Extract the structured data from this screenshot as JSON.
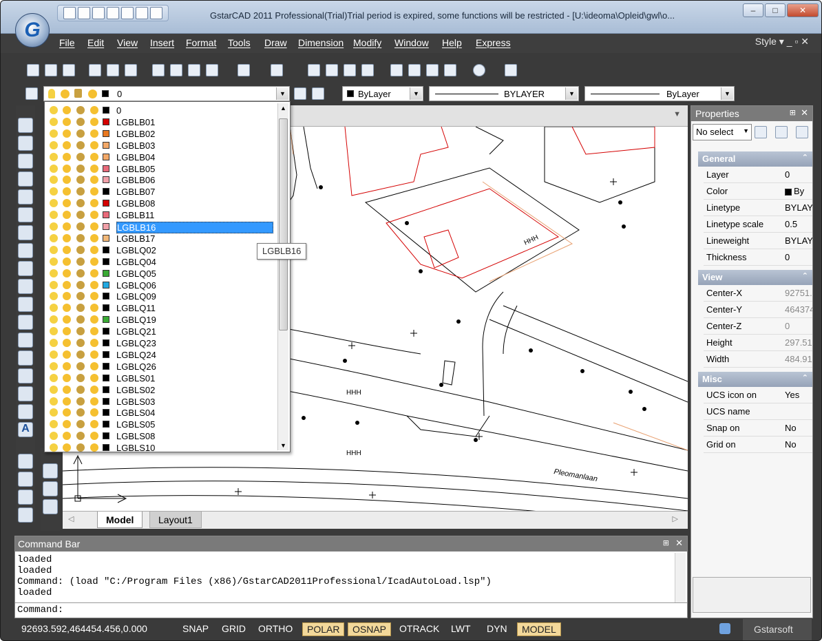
{
  "window": {
    "title": "GstarCAD 2011 Professional(Trial)Trial period is expired, some functions will be restricted - [U:\\ideoma\\Opleid\\gwl\\o...",
    "app_logo": "G",
    "min": "–",
    "max": "□",
    "close": "✕"
  },
  "menus": [
    "File",
    "Edit",
    "View",
    "Insert",
    "Format",
    "Tools",
    "Draw",
    "Dimension",
    "Modify",
    "Window",
    "Help",
    "Express"
  ],
  "style_label": "Style ▾ _ ▫ ✕",
  "layer_combo": {
    "value": "0"
  },
  "color_combo": {
    "value": "ByLayer"
  },
  "linetype_combo": {
    "value": "BYLAYER"
  },
  "lineweight_combo": {
    "value": "ByLayer"
  },
  "layer_dropdown": {
    "items": [
      {
        "name": "0",
        "color": "#000000"
      },
      {
        "name": "LGBLB01",
        "color": "#d40000"
      },
      {
        "name": "LGBLB02",
        "color": "#e87820"
      },
      {
        "name": "LGBLB03",
        "color": "#f2a868"
      },
      {
        "name": "LGBLB04",
        "color": "#f2a868"
      },
      {
        "name": "LGBLB05",
        "color": "#e86a7a"
      },
      {
        "name": "LGBLB06",
        "color": "#f0a0a8"
      },
      {
        "name": "LGBLB07",
        "color": "#000000"
      },
      {
        "name": "LGBLB08",
        "color": "#d40000"
      },
      {
        "name": "LGBLB11",
        "color": "#e86a7a"
      },
      {
        "name": "LGBLB16",
        "color": "#f0a0a8"
      },
      {
        "name": "LGBLB17",
        "color": "#f2b878"
      },
      {
        "name": "LGBLQ02",
        "color": "#000000"
      },
      {
        "name": "LGBLQ04",
        "color": "#000000"
      },
      {
        "name": "LGBLQ05",
        "color": "#3aaa35"
      },
      {
        "name": "LGBLQ06",
        "color": "#22a8e0"
      },
      {
        "name": "LGBLQ09",
        "color": "#000000"
      },
      {
        "name": "LGBLQ11",
        "color": "#000000"
      },
      {
        "name": "LGBLQ19",
        "color": "#3aaa35"
      },
      {
        "name": "LGBLQ21",
        "color": "#000000"
      },
      {
        "name": "LGBLQ23",
        "color": "#000000"
      },
      {
        "name": "LGBLQ24",
        "color": "#000000"
      },
      {
        "name": "LGBLQ26",
        "color": "#000000"
      },
      {
        "name": "LGBLS01",
        "color": "#000000"
      },
      {
        "name": "LGBLS02",
        "color": "#000000"
      },
      {
        "name": "LGBLS03",
        "color": "#000000"
      },
      {
        "name": "LGBLS04",
        "color": "#000000"
      },
      {
        "name": "LGBLS05",
        "color": "#000000"
      },
      {
        "name": "LGBLS08",
        "color": "#000000"
      },
      {
        "name": "LGBLS10",
        "color": "#000000"
      }
    ],
    "selected": "LGBLB16",
    "tooltip": "LGBLB16"
  },
  "drawing": {
    "street_label": "Pleomanlaan",
    "hatch_text": "HHH"
  },
  "tabs": [
    "Model",
    "Layout1"
  ],
  "properties": {
    "title": "Properties",
    "selector": "No select",
    "sections": [
      {
        "name": "General",
        "rows": [
          [
            "Layer",
            "0"
          ],
          [
            "Color",
            "By"
          ],
          [
            "Linetype",
            "BYLAY"
          ],
          [
            "Linetype scale",
            "0.5"
          ],
          [
            "Lineweight",
            "BYLAY"
          ],
          [
            "Thickness",
            "0"
          ]
        ]
      },
      {
        "name": "View",
        "rows": [
          [
            "Center-X",
            "92751."
          ],
          [
            "Center-Y",
            "464374"
          ],
          [
            "Center-Z",
            "0"
          ],
          [
            "Height",
            "297.51"
          ],
          [
            "Width",
            "484.91"
          ]
        ]
      },
      {
        "name": "Misc",
        "rows": [
          [
            "UCS icon on",
            "Yes"
          ],
          [
            "UCS name",
            ""
          ],
          [
            "Snap on",
            "No"
          ],
          [
            "Grid on",
            "No"
          ]
        ]
      }
    ]
  },
  "command_bar": {
    "title": "Command Bar",
    "lines": [
      "loaded",
      "loaded",
      "Command: (load \"C:/Program Files (x86)/GstarCAD2011Professional/IcadAutoLoad.lsp\")",
      "loaded"
    ],
    "prompt": "Command:"
  },
  "status": {
    "coords": "92693.592,464454.456,0.000",
    "buttons": [
      {
        "label": "SNAP",
        "on": false
      },
      {
        "label": "GRID",
        "on": false
      },
      {
        "label": "ORTHO",
        "on": false
      },
      {
        "label": "POLAR",
        "on": true
      },
      {
        "label": "OSNAP",
        "on": true
      },
      {
        "label": "OTRACK",
        "on": false
      },
      {
        "label": "LWT",
        "on": false
      },
      {
        "label": "DYN",
        "on": false
      },
      {
        "label": "MODEL",
        "on": true
      }
    ],
    "brand": "Gstarsoft"
  }
}
